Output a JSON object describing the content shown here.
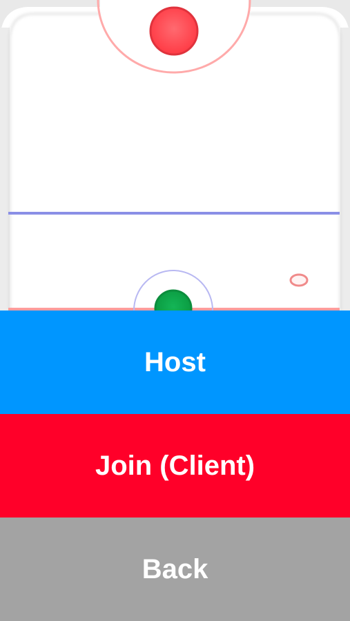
{
  "menu": {
    "host_label": "Host",
    "join_label": "Join (Client)",
    "back_label": "Back"
  },
  "colors": {
    "host_bg": "#0096ff",
    "join_bg": "#ff0029",
    "back_bg": "#a3a3a3",
    "opponent_mallet": "#ff4d55",
    "player_mallet": "#0fa84a",
    "center_line": "#8a8fe6",
    "goal_line": "#ff9d9d",
    "rink_border": "#e8e8e8"
  },
  "icons": {
    "opponent": "opponent-mallet-icon",
    "player": "player-mallet-icon",
    "puck": "puck-icon"
  }
}
